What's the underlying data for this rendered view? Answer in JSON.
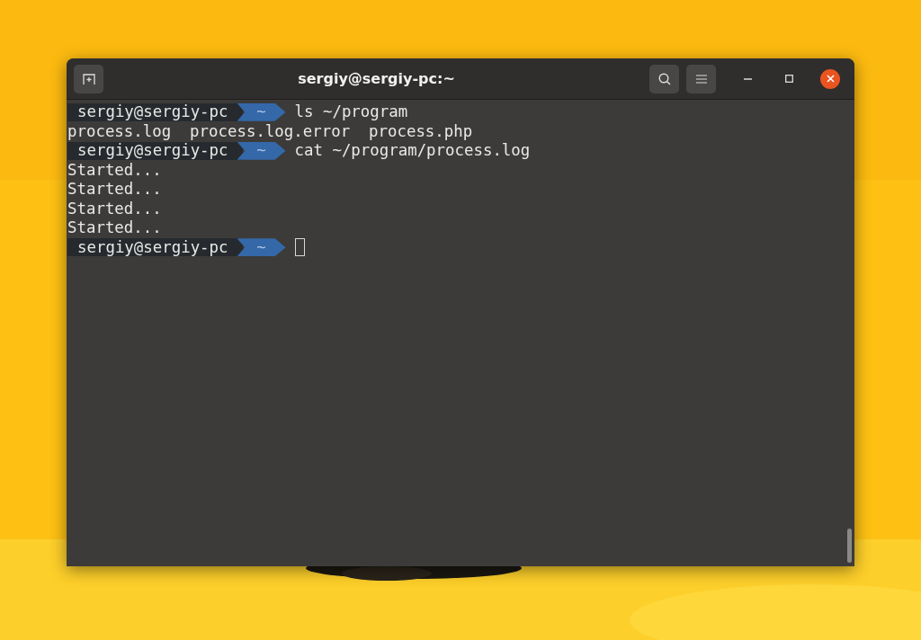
{
  "window": {
    "title": "sergiy@sergiy-pc:~"
  },
  "lines": [
    {
      "kind": "prompt",
      "user": "sergiy@sergiy-pc",
      "dir": "~",
      "command": "ls ~/program",
      "cursor": false
    },
    {
      "kind": "output",
      "text": "process.log  process.log.error  process.php"
    },
    {
      "kind": "prompt",
      "user": "sergiy@sergiy-pc",
      "dir": "~",
      "command": "cat ~/program/process.log",
      "cursor": false
    },
    {
      "kind": "output",
      "text": "Started..."
    },
    {
      "kind": "output",
      "text": "Started..."
    },
    {
      "kind": "output",
      "text": "Started..."
    },
    {
      "kind": "output",
      "text": "Started..."
    },
    {
      "kind": "prompt",
      "user": "sergiy@sergiy-pc",
      "dir": "~",
      "cursor": true
    }
  ]
}
